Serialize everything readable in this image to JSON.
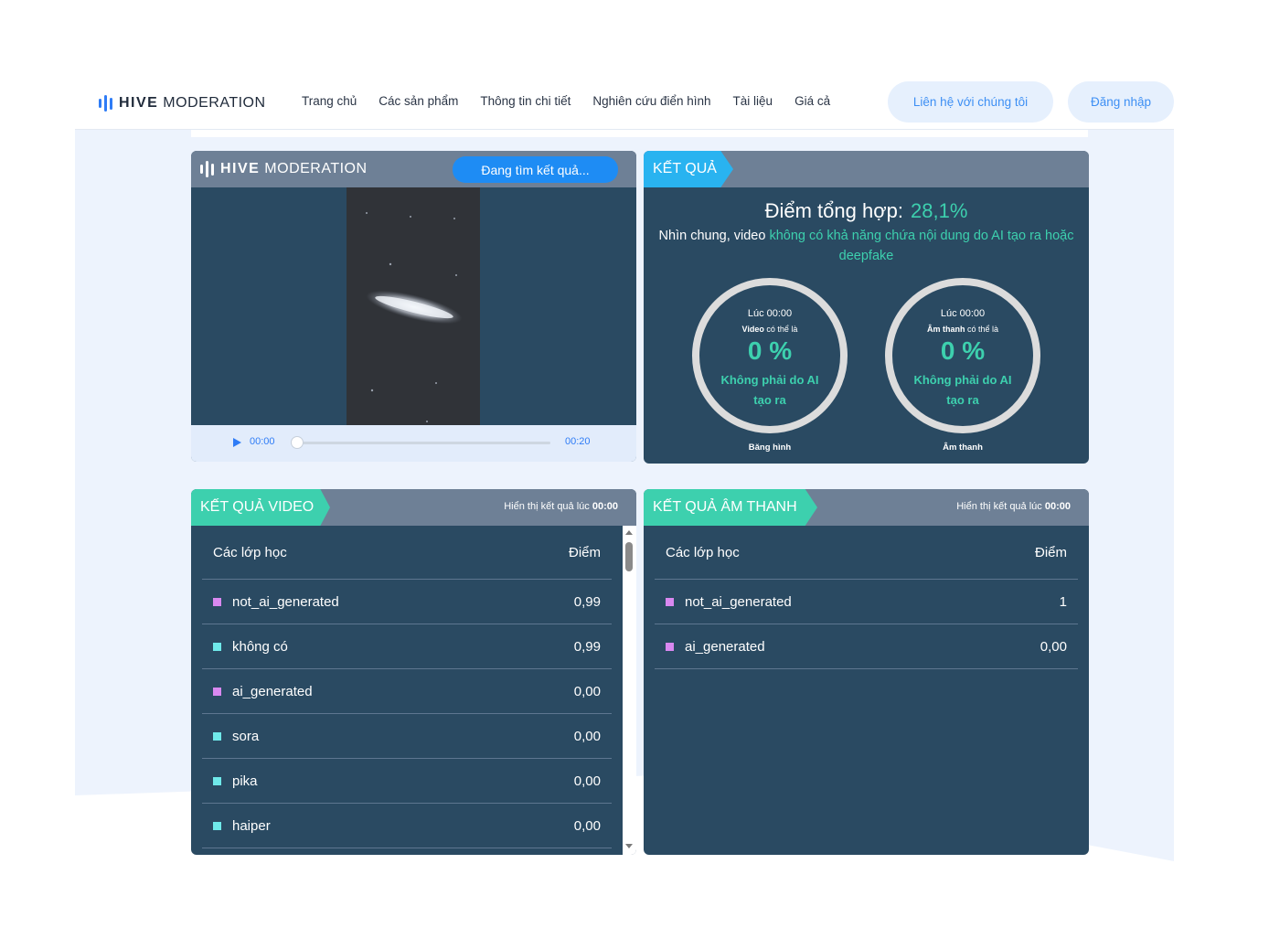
{
  "nav": {
    "logo_bold": "HIVE",
    "logo_light": "MODERATION",
    "links": [
      "Trang chủ",
      "Các sản phẩm",
      "Thông tin chi tiết",
      "Nghiên cứu điển hình",
      "Tài liệu",
      "Giá cả"
    ],
    "contact_label": "Liên hệ với chúng tôi",
    "login_label": "Đăng nhập"
  },
  "video_panel": {
    "logo_bold": "HIVE",
    "logo_light": "MODERATION",
    "searching_label": "Đang tìm kết quả...",
    "current_time": "00:00",
    "duration": "00:20",
    "progress": 0
  },
  "result_panel": {
    "tag": "KẾT QUẢ",
    "overall_label": "Điểm tổng hợp:",
    "overall_score": "28,1%",
    "summary_prefix": "Nhìn chung, video",
    "summary_highlight": "không có khả năng chứa nội dung do AI tạo ra hoặc deepfake",
    "video_ring": {
      "time": "Lúc 00:00",
      "may_bold": "Video",
      "may_rest": "có thể là",
      "percent": "0 %",
      "label": "Không phải do AI tạo ra",
      "caption": "Băng hình"
    },
    "audio_ring": {
      "time": "Lúc 00:00",
      "may_bold": "Âm thanh",
      "may_rest": "có thể là",
      "percent": "0 %",
      "label": "Không phải do AI tạo ra",
      "caption": "Âm thanh"
    }
  },
  "video_results": {
    "tag": "KẾT QUẢ VIDEO",
    "show_at_prefix": "Hiển thị kết quả lúc",
    "show_at_time": "00:00",
    "col_class": "Các lớp học",
    "col_score": "Điểm",
    "rows": [
      {
        "label": "not_ai_generated",
        "score": "0,99",
        "color": "#d988f0"
      },
      {
        "label": "không có",
        "score": "0,99",
        "color": "#6fe9ea"
      },
      {
        "label": "ai_generated",
        "score": "0,00",
        "color": "#d988f0"
      },
      {
        "label": "sora",
        "score": "0,00",
        "color": "#6fe9ea"
      },
      {
        "label": "pika",
        "score": "0,00",
        "color": "#6fe9ea"
      },
      {
        "label": "haiper",
        "score": "0,00",
        "color": "#6fe9ea"
      }
    ]
  },
  "audio_results": {
    "tag": "KẾT QUẢ ÂM THANH",
    "show_at_prefix": "Hiển thị kết quả lúc",
    "show_at_time": "00:00",
    "col_class": "Các lớp học",
    "col_score": "Điểm",
    "rows": [
      {
        "label": "not_ai_generated",
        "score": "1",
        "color": "#d988f0"
      },
      {
        "label": "ai_generated",
        "score": "0,00",
        "color": "#d988f0"
      }
    ]
  },
  "colors": {
    "panel_bg": "#2a4a62",
    "panel_header": "#6e8096",
    "accent_green": "#3dd0ae",
    "accent_blue": "#29b3f0",
    "brand_blue": "#2f7cf6"
  }
}
